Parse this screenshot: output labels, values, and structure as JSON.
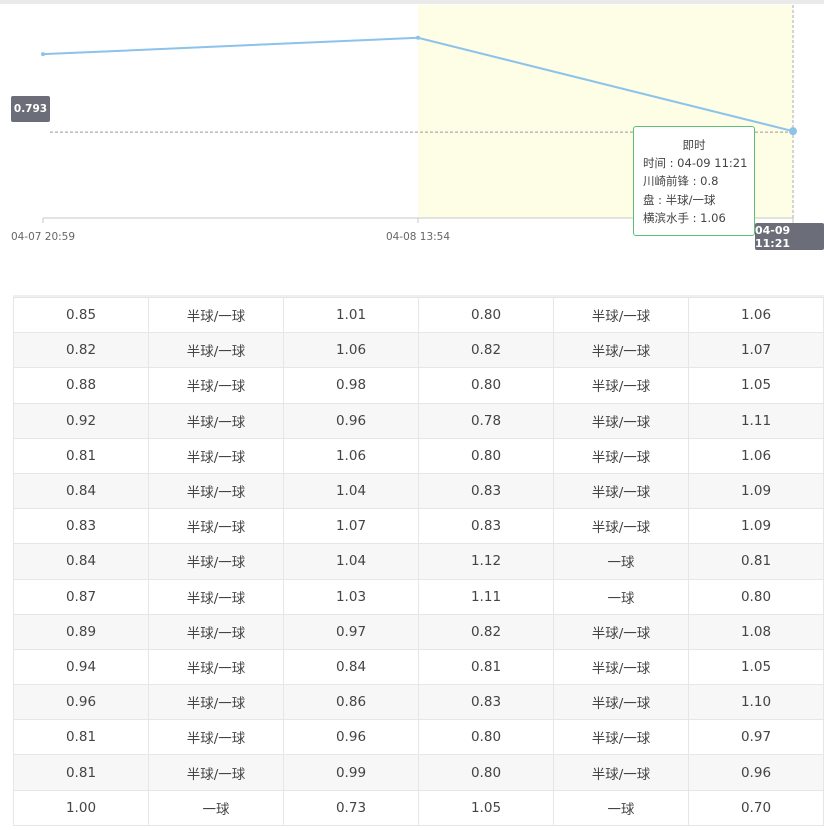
{
  "chart_data": {
    "type": "line",
    "title": "",
    "x": [
      "04-07 20:59",
      "04-08 13:54",
      "04-09 11:21"
    ],
    "series": [
      {
        "values": [
          0.84,
          0.85,
          0.793
        ]
      }
    ],
    "x_tick_labels": [
      "04-07 20:59",
      "04-08 13:54"
    ],
    "ylim": [
      0.74,
      0.87
    ],
    "grid": false,
    "highlight_range": [
      "04-08 13:54",
      "04-09 11:21"
    ],
    "crosshair": {
      "y_label": "0.793",
      "x_label": "04-09 11:21"
    },
    "tooltip": {
      "title": "即时",
      "lines": [
        "时间 : 04-09 11:21",
        "川崎前锋 : 0.8",
        "盘 : 半球/一球",
        "横滨水手 : 1.06"
      ]
    },
    "colors": {
      "line": "#8cc3ea",
      "highlight": "#fefde6",
      "label_bg": "#6b6e78",
      "tooltip_border": "#5fbf78"
    }
  },
  "table": {
    "rows": [
      [
        "0.85",
        "半球/一球",
        "1.01",
        "0.80",
        "半球/一球",
        "1.06"
      ],
      [
        "0.82",
        "半球/一球",
        "1.06",
        "0.82",
        "半球/一球",
        "1.07"
      ],
      [
        "0.88",
        "半球/一球",
        "0.98",
        "0.80",
        "半球/一球",
        "1.05"
      ],
      [
        "0.92",
        "半球/一球",
        "0.96",
        "0.78",
        "半球/一球",
        "1.11"
      ],
      [
        "0.81",
        "半球/一球",
        "1.06",
        "0.80",
        "半球/一球",
        "1.06"
      ],
      [
        "0.84",
        "半球/一球",
        "1.04",
        "0.83",
        "半球/一球",
        "1.09"
      ],
      [
        "0.83",
        "半球/一球",
        "1.07",
        "0.83",
        "半球/一球",
        "1.09"
      ],
      [
        "0.84",
        "半球/一球",
        "1.04",
        "1.12",
        "一球",
        "0.81"
      ],
      [
        "0.87",
        "半球/一球",
        "1.03",
        "1.11",
        "一球",
        "0.80"
      ],
      [
        "0.89",
        "半球/一球",
        "0.97",
        "0.82",
        "半球/一球",
        "1.08"
      ],
      [
        "0.94",
        "半球/一球",
        "0.84",
        "0.81",
        "半球/一球",
        "1.05"
      ],
      [
        "0.96",
        "半球/一球",
        "0.86",
        "0.83",
        "半球/一球",
        "1.10"
      ],
      [
        "0.81",
        "半球/一球",
        "0.96",
        "0.80",
        "半球/一球",
        "0.97"
      ],
      [
        "0.81",
        "半球/一球",
        "0.99",
        "0.80",
        "半球/一球",
        "0.96"
      ],
      [
        "1.00",
        "一球",
        "0.73",
        "1.05",
        "一球",
        "0.70"
      ]
    ]
  }
}
